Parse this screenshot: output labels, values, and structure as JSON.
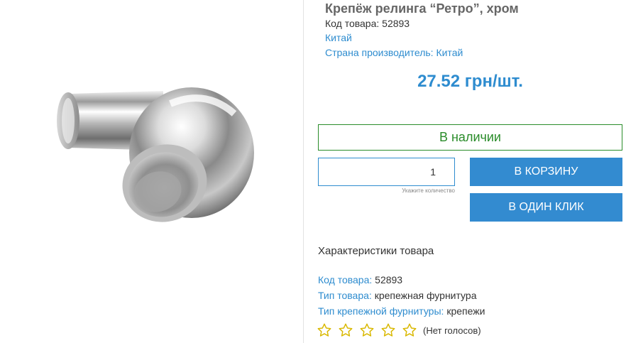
{
  "product": {
    "title": "Крепёж релинга “Ретро”, хром",
    "code_line": "Код товара: 52893",
    "brand_link": "Китай",
    "country_link": "Страна производитель: Китай",
    "price": "27.52 грн/шт.",
    "stock_status": "В наличии",
    "quantity_value": "1",
    "quantity_hint": "Укажите количество",
    "add_to_cart": "В КОРЗИНУ",
    "one_click": "В ОДИН КЛИК"
  },
  "characteristics": {
    "title": "Характеристики товара",
    "rows": [
      {
        "key": "Код товара:",
        "value": "52893"
      },
      {
        "key": "Тип товара:",
        "value": "крепежная фурнитура"
      },
      {
        "key": "Тип крепежной фурнитуры:",
        "value": "крепежи"
      }
    ]
  },
  "rating": {
    "stars": 5,
    "filled": 0,
    "star_icon": "star-outline-icon",
    "votes_text": "(Нет голосов)"
  },
  "colors": {
    "accent": "#338bd0",
    "stock_green": "#2a8c2a",
    "star_stroke": "#d9b800"
  }
}
